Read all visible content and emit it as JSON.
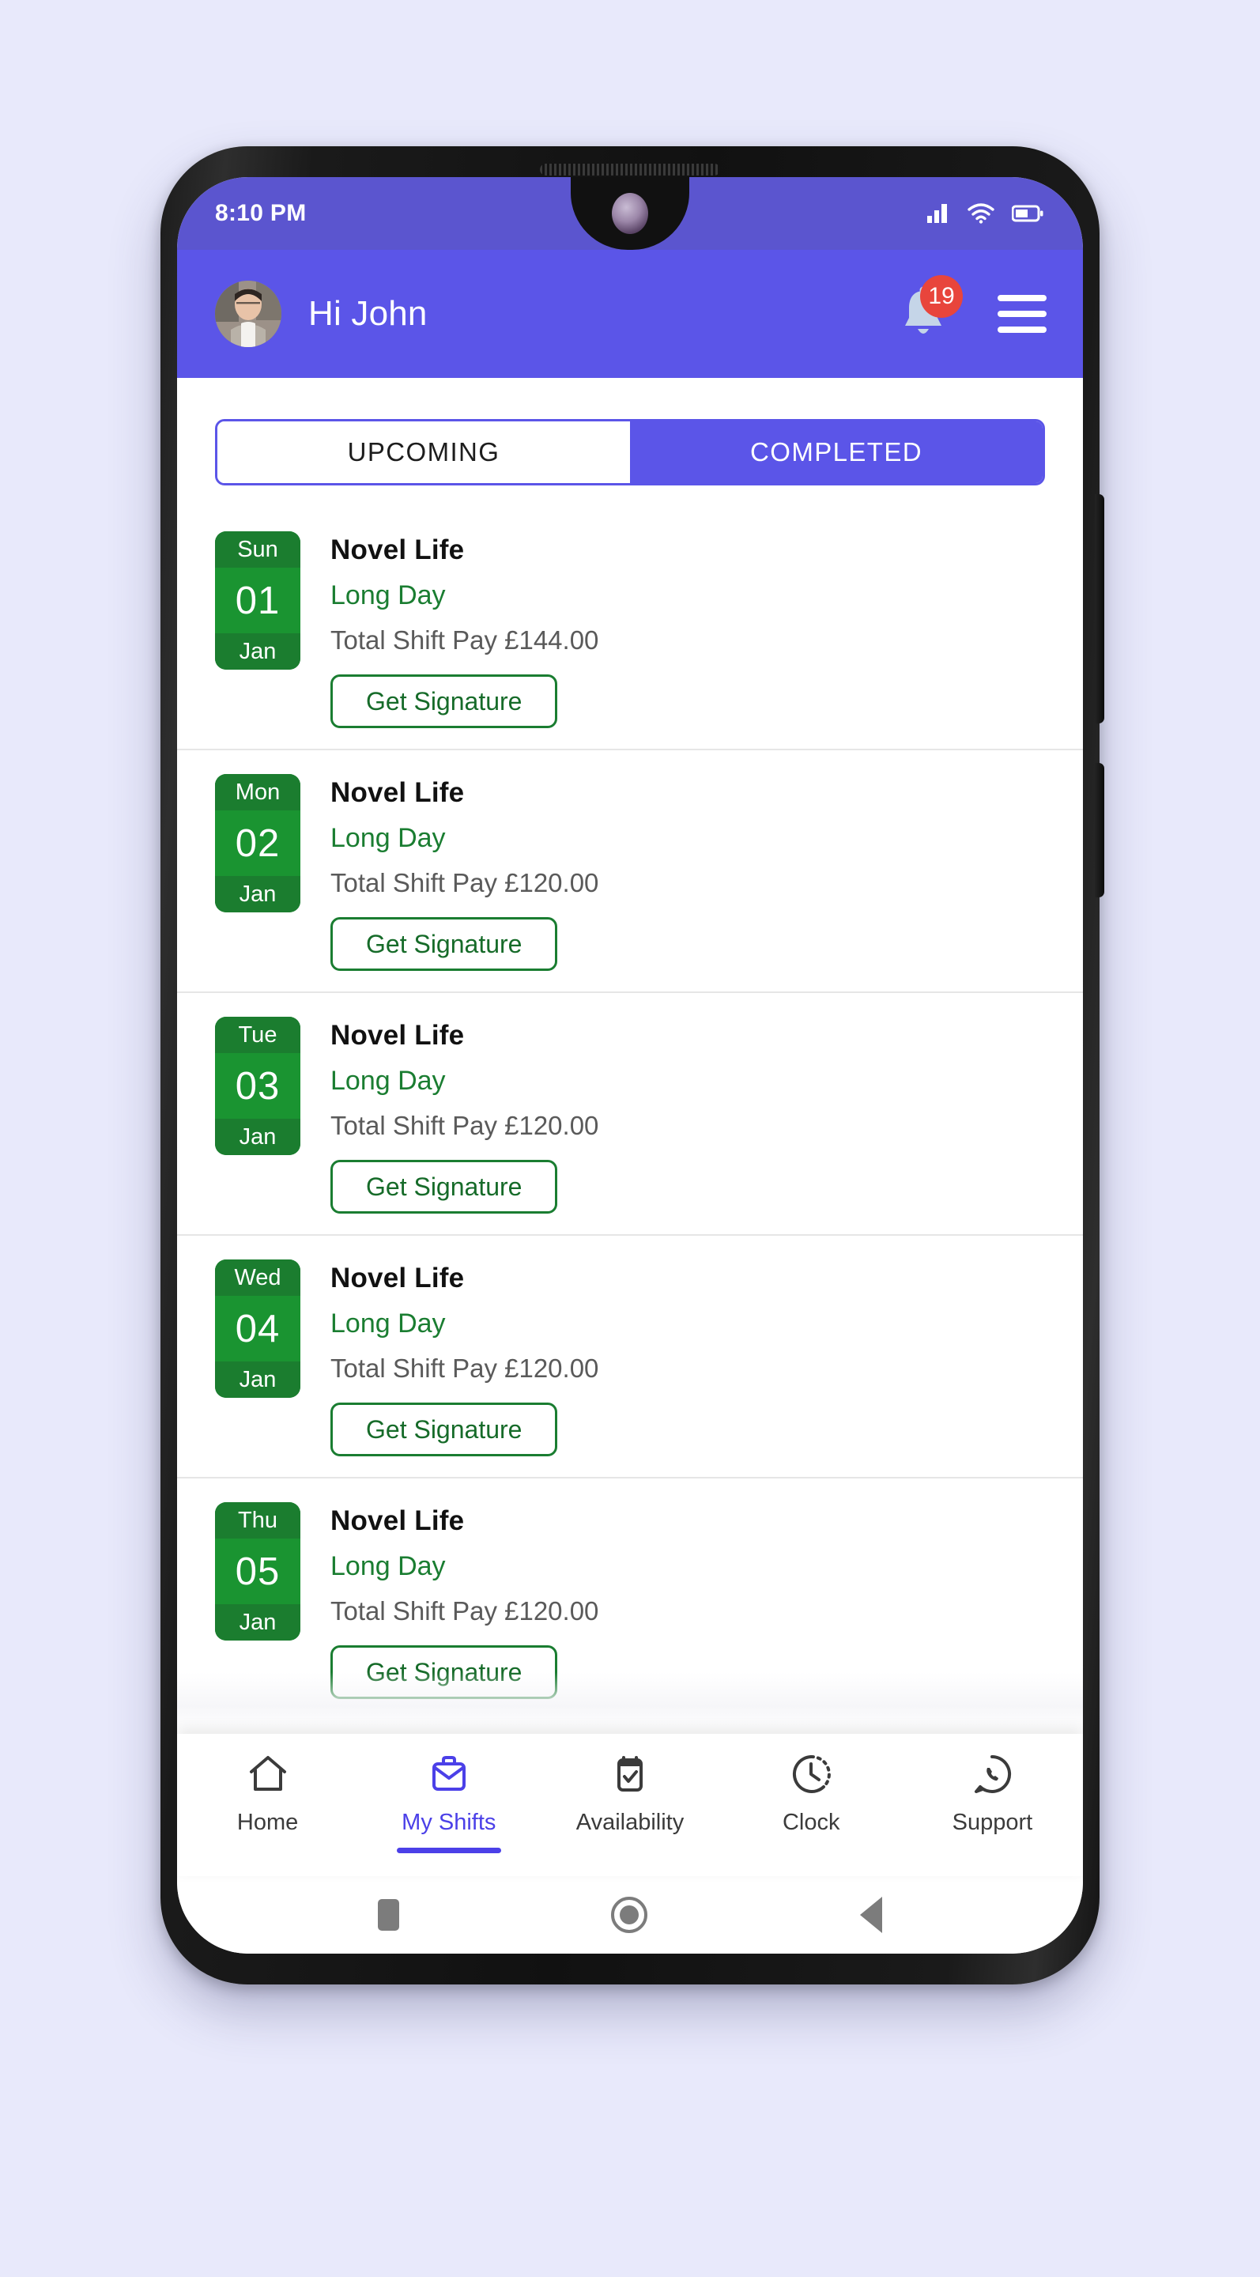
{
  "status_bar": {
    "time": "8:10 PM",
    "icons": [
      "signal-icon",
      "wifi-icon",
      "battery-icon"
    ]
  },
  "header": {
    "greeting": "Hi John",
    "avatar": "avatar",
    "bell_icon": "bell-icon",
    "notification_count": "19",
    "menu_icon": "hamburger-menu-icon"
  },
  "tabs": [
    {
      "label": "UPCOMING",
      "active": false
    },
    {
      "label": "COMPLETED",
      "active": true
    }
  ],
  "shifts": [
    {
      "dow": "Sun",
      "day": "01",
      "month": "Jan",
      "client": "Novel Life",
      "type": "Long Day",
      "pay": "Total Shift Pay £144.00",
      "action": "Get Signature"
    },
    {
      "dow": "Mon",
      "day": "02",
      "month": "Jan",
      "client": "Novel Life",
      "type": "Long Day",
      "pay": "Total Shift Pay £120.00",
      "action": "Get Signature"
    },
    {
      "dow": "Tue",
      "day": "03",
      "month": "Jan",
      "client": "Novel Life",
      "type": "Long Day",
      "pay": "Total Shift Pay £120.00",
      "action": "Get Signature"
    },
    {
      "dow": "Wed",
      "day": "04",
      "month": "Jan",
      "client": "Novel Life",
      "type": "Long Day",
      "pay": "Total Shift Pay £120.00",
      "action": "Get Signature"
    },
    {
      "dow": "Thu",
      "day": "05",
      "month": "Jan",
      "client": "Novel Life",
      "type": "Long Day",
      "pay": "Total Shift Pay £120.00",
      "action": "Get Signature"
    }
  ],
  "bottom_nav": [
    {
      "label": "Home",
      "icon": "home-icon",
      "active": false
    },
    {
      "label": "My Shifts",
      "icon": "briefcase-icon",
      "active": true
    },
    {
      "label": "Availability",
      "icon": "calendar-check-icon",
      "active": false
    },
    {
      "label": "Clock",
      "icon": "clock-icon",
      "active": false
    },
    {
      "label": "Support",
      "icon": "whatsapp-icon",
      "active": false
    }
  ],
  "system_nav": [
    {
      "icon": "recents-square-icon"
    },
    {
      "icon": "home-circle-icon"
    },
    {
      "icon": "back-triangle-icon"
    }
  ],
  "colors": {
    "brand_purple": "#5B55E8",
    "status_bar_purple": "#5B55CF",
    "green": "#1A9431",
    "green_dark": "#1B7D2F",
    "badge_red": "#E8453C",
    "page_background": "#E8E9FB"
  }
}
